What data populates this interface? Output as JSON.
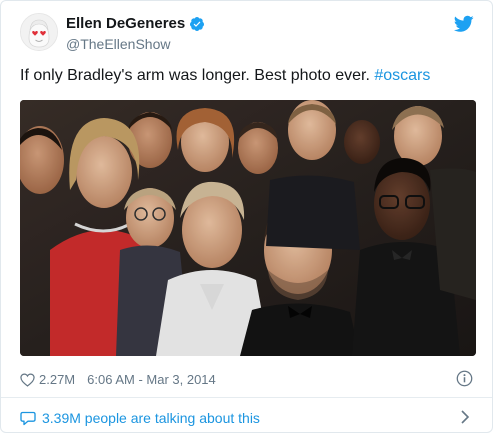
{
  "author": {
    "display_name": "Ellen DeGeneres",
    "handle": "@TheEllenShow",
    "verified": true,
    "avatar_icon": "heart-eyes-emoji-avatar"
  },
  "tweet": {
    "text_main": "If only Bradley's arm was longer. Best photo ever. ",
    "hashtag": "#oscars",
    "media_icon": "group-selfie-photo"
  },
  "meta": {
    "likes": "2.27M",
    "timestamp": "6:06 AM - Mar 3, 2014",
    "like_icon": "heart-outline-icon",
    "info_icon": "info-icon"
  },
  "footer": {
    "talking_text": "3.39M people are talking about this",
    "bubble_icon": "speech-bubble-icon",
    "chevron_icon": "chevron-right-icon"
  },
  "colors": {
    "link": "#1b95e0",
    "text": "#14171a",
    "muted": "#657786",
    "border": "#e1e8ed",
    "twitter_blue": "#1da1f2",
    "heart_emoji_red": "#e0303a"
  }
}
